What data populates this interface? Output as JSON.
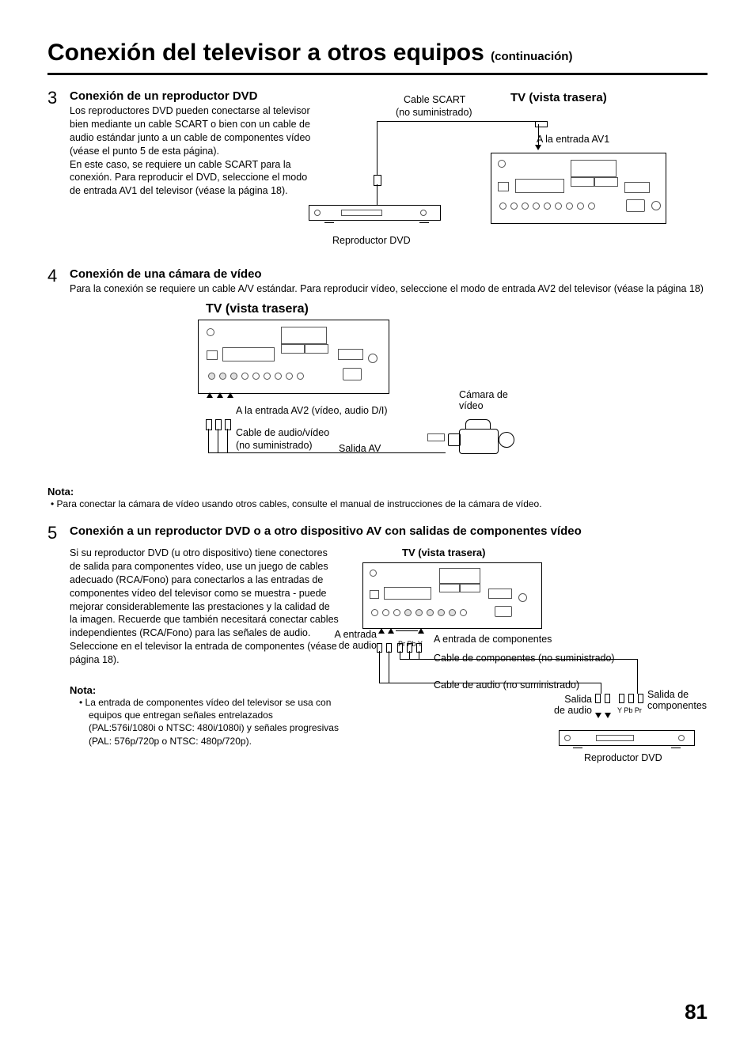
{
  "title_main": "Conexión del televisor a otros equipos ",
  "title_suffix": "(continuación)",
  "step3": {
    "num": "3",
    "head": "Conexión de un reproductor DVD",
    "para": "Los reproductores DVD pueden conectarse al televisor bien mediante un cable SCART o bien con un cable de audio estándar junto a un cable de componentes vídeo (véase el punto 5 de esta página).\nEn este caso, se requiere un cable SCART para la conexión. Para reproducir el DVD, seleccione el modo de entrada AV1 del televisor (véase la página 18).",
    "lbl_scart": "Cable SCART",
    "lbl_scart_sub": "(no suministrado)",
    "lbl_tv": "TV (vista trasera)",
    "lbl_av1": "A la entrada AV1",
    "lbl_dvd": "Reproductor DVD"
  },
  "step4": {
    "num": "4",
    "head": "Conexión de una cámara de vídeo",
    "para": "Para la conexión se requiere un cable A/V estándar. Para reproducir vídeo, seleccione el modo de entrada AV2 del televisor (véase la página 18)",
    "lbl_tv": "TV (vista trasera)",
    "lbl_av2": "A la entrada AV2 (vídeo, audio D/I)",
    "lbl_cable": "Cable de audio/vídeo",
    "lbl_cable_sub": "(no suministrado)",
    "lbl_avout": "Salida AV",
    "lbl_cam": "Cámara de\nvídeo",
    "note_head": "Nota:",
    "note_body": "• Para conectar la cámara de vídeo usando otros cables, consulte el manual de instrucciones de la cámara de vídeo."
  },
  "step5": {
    "num": "5",
    "head": "Conexión a un reproductor DVD o a otro dispositivo AV con salidas de componentes vídeo",
    "para": "Si su reproductor DVD (u otro dispositivo) tiene conectores de salida para componentes vídeo, use un juego de cables adecuado (RCA/Fono) para conectarlos a las entradas de componentes vídeo del televisor como se muestra - puede mejorar considerablemente las prestaciones y la calidad de la imagen. Recuerde que también necesitará conectar cables independientes (RCA/Fono) para las señales de audio. Seleccione en el televisor la entrada de componentes (véase página 18).",
    "note_head": "Nota:",
    "note_body": "• La entrada de componentes vídeo del televisor se usa con equipos que entregan señales entrelazados (PAL:576i/1080i o NTSC: 480i/1080i) y señales progresivas (PAL: 576p/720p o NTSC: 480p/720p).",
    "lbl_tv": "TV (vista trasera)",
    "lbl_audio_in": "A entrada\nde audio",
    "lbl_comp_in": "A entrada de componentes",
    "lbl_comp_cable": "Cable de componentes (no suministrado)",
    "lbl_audio_cable": "Cable de audio (no suministrado)",
    "lbl_audio_out": "Salida\nde audio",
    "lbl_comp_out": "Salida de\ncomponentes",
    "lbl_dvd": "Reproductor DVD",
    "lbl_ypbpr1": "Pr Pb Y",
    "lbl_ypbpr2": "Y Pb Pr"
  },
  "page_number": "81"
}
